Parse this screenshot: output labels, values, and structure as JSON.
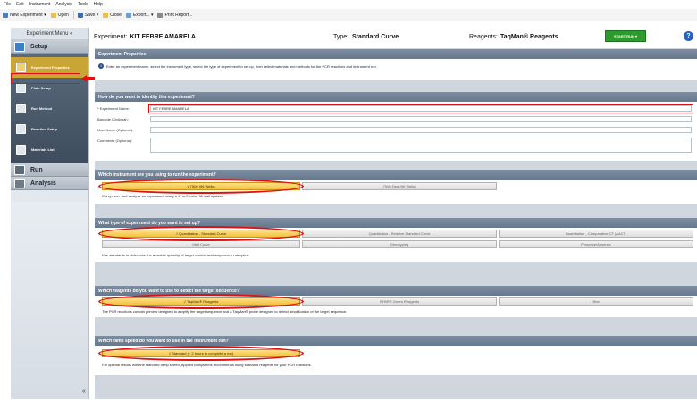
{
  "menubar": [
    "File",
    "Edit",
    "Instrument",
    "Analysis",
    "Tools",
    "Help"
  ],
  "toolbar": {
    "new_experiment": "New Experiment",
    "open": "Open",
    "save": "Save",
    "close": "Close",
    "export": "Export...",
    "print_report": "Print Report..."
  },
  "sidebar": {
    "title": "Experiment Menu «",
    "setup": "Setup",
    "setup_items": [
      "Experiment Properties",
      "Plate Setup",
      "Run Method",
      "Reaction Setup",
      "Materials List"
    ],
    "run": "Run",
    "analysis": "Analysis",
    "collapse": "«"
  },
  "header": {
    "experiment_label": "Experiment:",
    "experiment_name": "KIT FEBRE AMARELA",
    "type_label": "Type:",
    "type_value": "Standard Curve",
    "reagents_label": "Reagents:",
    "reagents_value": "TaqMan® Reagents",
    "start_run": "START RUN",
    "help": "?"
  },
  "properties": {
    "title": "Experiment Properties",
    "intro": "Enter an experiment name, select the instrument type, select the type of experiment to set up, then select materials and methods for the PCR reactions and instrument run."
  },
  "identify": {
    "title": "How do you want to identify this experiment?",
    "name_label": "* Experiment Name:",
    "name_value": "KIT FEBRE AMARELA",
    "barcode_label": "Barcode (Optional):",
    "user_label": "User Name (Optional):",
    "comments_label": "Comments (Optional):"
  },
  "instrument": {
    "title": "Which instrument are you using to run the experiment?",
    "options": [
      "√ 7500 (96 Wells)",
      "7500 Fast (96 Wells)"
    ],
    "note": "Set up, run, and analyze an experiment using a 4- or 5-color, 96-well system."
  },
  "experiment_type": {
    "title": "What type of experiment do you want to set up?",
    "options_row1": [
      "√ Quantitation - Standard Curve",
      "Quantitation - Relative Standard Curve",
      "Quantitation - Comparative CT (ΔΔCT)"
    ],
    "options_row2": [
      "Melt Curve",
      "Genotyping",
      "Presence/Absence"
    ],
    "note": "Use standards to determine the absolute quantity of target nucleic acid sequence in samples."
  },
  "reagents": {
    "title": "Which reagents do you want to use to detect the target sequence?",
    "options": [
      "√ TaqMan® Reagents",
      "SYBR® Green Reagents",
      "Other"
    ],
    "note": "The PCR reactions contain primers designed to amplify the target sequence and a TaqMan® probe designed to detect amplification of the target sequence."
  },
  "ramp": {
    "title": "Which ramp speed do you want to use in the instrument run?",
    "options": [
      "√ Standard (~ 2 hours to complete a run)"
    ],
    "note": "For optimal results with the standard ramp speed, Applied Biosystems recommends using standard reagents for your PCR reactions."
  },
  "colors": {
    "accent": "#e01010",
    "selected": "#f2c23c",
    "start": "#2c9a2c",
    "section_bar": "#73849a"
  }
}
